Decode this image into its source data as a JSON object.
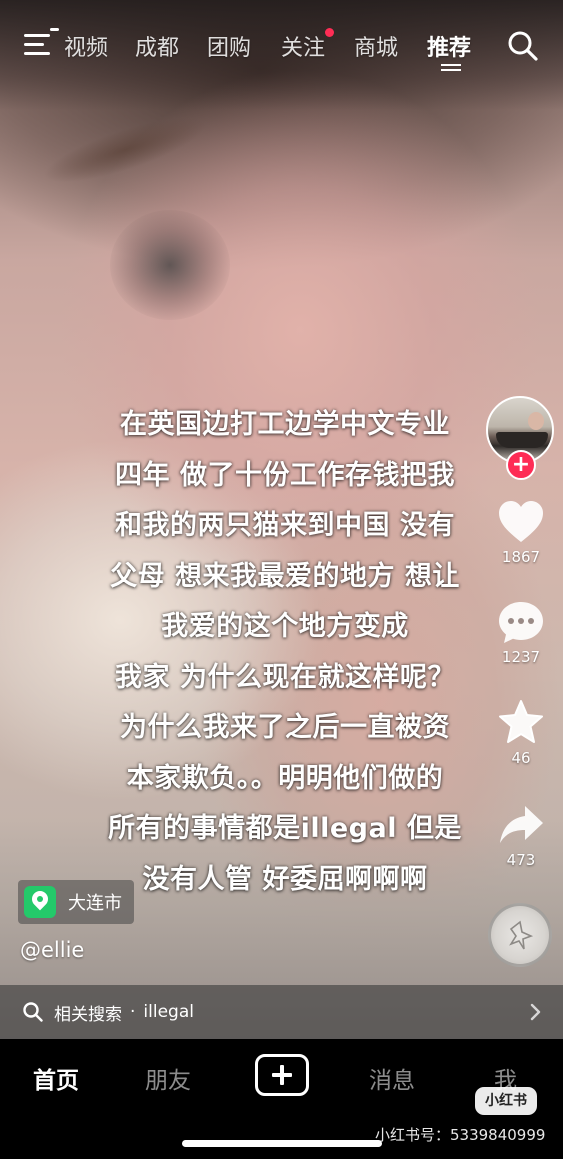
{
  "top_nav": {
    "tabs": [
      {
        "label": "视频",
        "active": false,
        "badge": false
      },
      {
        "label": "成都",
        "active": false,
        "badge": false
      },
      {
        "label": "团购",
        "active": false,
        "badge": false
      },
      {
        "label": "关注",
        "active": false,
        "badge": true
      },
      {
        "label": "商城",
        "active": false,
        "badge": false
      },
      {
        "label": "推荐",
        "active": true,
        "badge": false
      }
    ],
    "menu_badge": true
  },
  "caption": {
    "lines": [
      "在英国边打工边学中文专业",
      "四年 做了十份工作存钱把我",
      "和我的两只猫来到中国 没有",
      "父母 想来我最爱的地方 想让",
      "我爱的这个地方变成",
      "我家 为什么现在就这样呢？",
      "为什么我来了之后一直被资",
      "本家欺负。。明明他们做的",
      "所有的事情都是illegal 但是",
      "没有人管 好委屈啊啊啊"
    ]
  },
  "rail": {
    "follow_symbol": "+",
    "like_count": "1867",
    "comment_count": "1237",
    "favorite_count": "46",
    "share_count": "473",
    "icons": {
      "like": "heart-icon",
      "comment": "comment-bubble-icon",
      "favorite": "star-icon",
      "share": "share-arrow-icon"
    }
  },
  "location": {
    "label": "大连市"
  },
  "author": {
    "handle": "@ellie"
  },
  "related_search": {
    "label": "相关搜索",
    "separator": "·",
    "term": "illegal"
  },
  "bottom_nav": {
    "items": [
      {
        "label": "首页",
        "active": true
      },
      {
        "label": "朋友",
        "active": false
      },
      {
        "label": "消息",
        "active": false
      },
      {
        "label": "我",
        "active": false
      }
    ]
  },
  "watermark": {
    "logo_text": "小红书",
    "id_text": "小红书号：5339840999"
  },
  "colors": {
    "accent_red": "#fe2c55",
    "location_green": "#24c96a",
    "text": "#ffffff"
  }
}
